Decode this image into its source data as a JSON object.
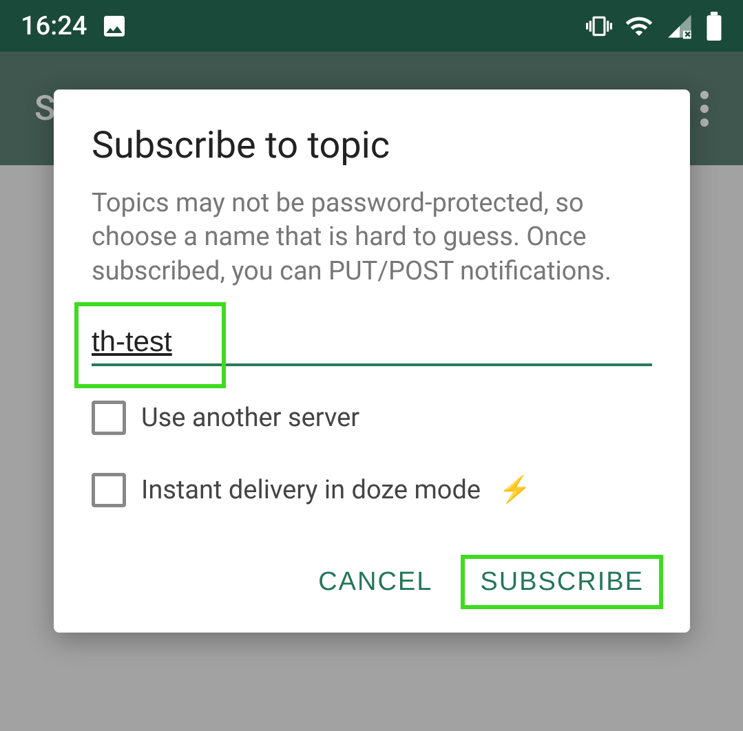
{
  "status": {
    "time": "16:24",
    "icons": {
      "image": "image-icon",
      "vibrate": "vibrate-icon",
      "wifi": "wifi-icon",
      "signal": "signal-icon",
      "battery": "battery-icon"
    }
  },
  "header": {
    "title": "S"
  },
  "dialog": {
    "title": "Subscribe to topic",
    "description": "Topics may not be password-protected, so choose a name that is hard to guess. Once subscribed, you can PUT/POST notifications.",
    "input_value": "th-test",
    "checkbox1_label": "Use another server",
    "checkbox1_checked": false,
    "checkbox2_label": "Instant delivery in doze mode",
    "checkbox2_checked": false,
    "cancel_label": "CANCEL",
    "subscribe_label": "SUBSCRIBE"
  },
  "highlights": {
    "input_highlighted": true,
    "subscribe_highlighted": true
  }
}
